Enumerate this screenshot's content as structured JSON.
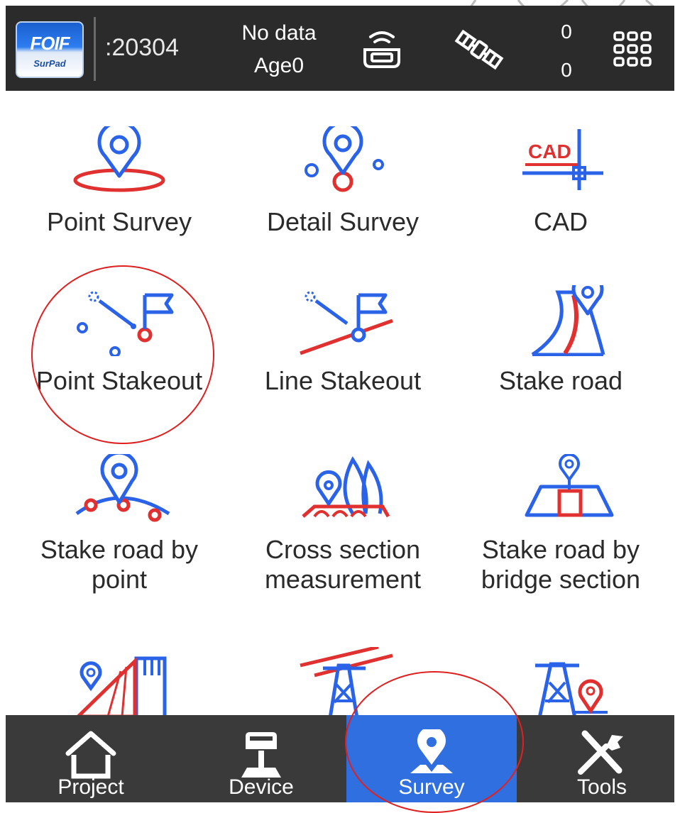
{
  "status_bar": {
    "logo_text": "FOIF",
    "logo_sub": "SurPad",
    "device_id": ":20304",
    "solution_status": "No data",
    "age": "Age0",
    "sat_count_top": "0",
    "sat_count_bottom": "0",
    "icons": [
      "receiver-icon",
      "satellite-icon",
      "grid-menu-icon"
    ]
  },
  "functions": [
    {
      "label": "Point Survey",
      "icon": "point-survey-icon"
    },
    {
      "label": "Detail Survey",
      "icon": "detail-survey-icon"
    },
    {
      "label": "CAD",
      "icon": "cad-icon",
      "icon_text": "CAD"
    },
    {
      "label": "Point Stakeout",
      "icon": "point-stakeout-icon"
    },
    {
      "label": "Line Stakeout",
      "icon": "line-stakeout-icon"
    },
    {
      "label": "Stake road",
      "icon": "stake-road-icon"
    },
    {
      "label": "Stake road by point",
      "label_line1": "Stake road by",
      "label_line2": "point",
      "icon": "stake-road-by-point-icon"
    },
    {
      "label": "Cross section measurement",
      "label_line1": "Cross section",
      "label_line2": "measurement",
      "icon": "cross-section-icon"
    },
    {
      "label": "Stake road by bridge section",
      "label_line1": "Stake road by",
      "label_line2": "bridge section",
      "icon": "bridge-section-icon"
    },
    {
      "label": "",
      "icon": "tunnel-icon"
    },
    {
      "label": "",
      "icon": "power-line-icon"
    },
    {
      "label": "",
      "icon": "tower-stakeout-icon"
    }
  ],
  "bottom_nav": [
    {
      "label": "Project",
      "icon": "home-icon",
      "active": false
    },
    {
      "label": "Device",
      "icon": "receiver-device-icon",
      "active": false
    },
    {
      "label": "Survey",
      "icon": "survey-pin-icon",
      "active": true
    },
    {
      "label": "Tools",
      "icon": "tools-icon",
      "active": false
    }
  ],
  "colors": {
    "accent_blue": "#2f6fe0",
    "icon_blue": "#2a62e8",
    "icon_red": "#e03030",
    "status_bar_bg": "#2b2b2b",
    "nav_bg": "#3a3a3a"
  }
}
